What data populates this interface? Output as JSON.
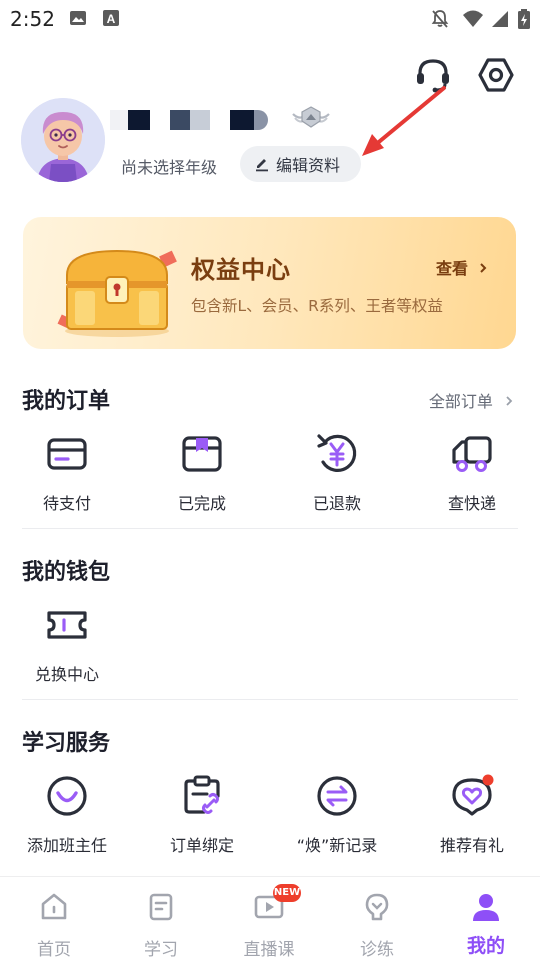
{
  "status_bar": {
    "time": "2:52",
    "icons": [
      "image-icon",
      "a-letter-icon",
      "notifications-off-icon",
      "wifi-icon",
      "signal-icon",
      "battery-icon"
    ]
  },
  "header": {
    "icons": [
      "customer-service-icon",
      "settings-icon"
    ]
  },
  "profile": {
    "grade_text": "尚未选择年级",
    "edit_label": "编辑资料"
  },
  "benefit_card": {
    "title": "权益中心",
    "view_label": "查看",
    "description": "包含新L、会员、R系列、王者等权益"
  },
  "orders": {
    "title": "我的订单",
    "all_link": "全部订单",
    "items": [
      {
        "label": "待支付",
        "icon": "card-icon"
      },
      {
        "label": "已完成",
        "icon": "bookmark-box-icon"
      },
      {
        "label": "已退款",
        "icon": "yen-refund-icon"
      },
      {
        "label": "查快递",
        "icon": "truck-icon"
      }
    ]
  },
  "wallet": {
    "title": "我的钱包",
    "items": [
      {
        "label": "兑换中心",
        "icon": "ticket-icon"
      }
    ]
  },
  "services": {
    "title": "学习服务",
    "items": [
      {
        "label": "添加班主任",
        "icon": "smile-icon"
      },
      {
        "label": "订单绑定",
        "icon": "clipboard-link-icon"
      },
      {
        "label": "“焕”新记录",
        "icon": "exchange-icon"
      },
      {
        "label": "推荐有礼",
        "icon": "heart-bubble-icon"
      }
    ]
  },
  "bottom_nav": {
    "new_badge": "NEW",
    "items": [
      {
        "label": "首页",
        "icon": "home-icon"
      },
      {
        "label": "学习",
        "icon": "document-icon"
      },
      {
        "label": "直播课",
        "icon": "play-screen-icon"
      },
      {
        "label": "诊练",
        "icon": "bulb-icon"
      },
      {
        "label": "我的",
        "icon": "person-icon"
      }
    ],
    "active_index": 4
  },
  "colors": {
    "accent": "#8e4ff7",
    "icon_dark": "#2b2f3a",
    "arrow_red": "#e53935",
    "badge_red": "#ee3e2c"
  }
}
